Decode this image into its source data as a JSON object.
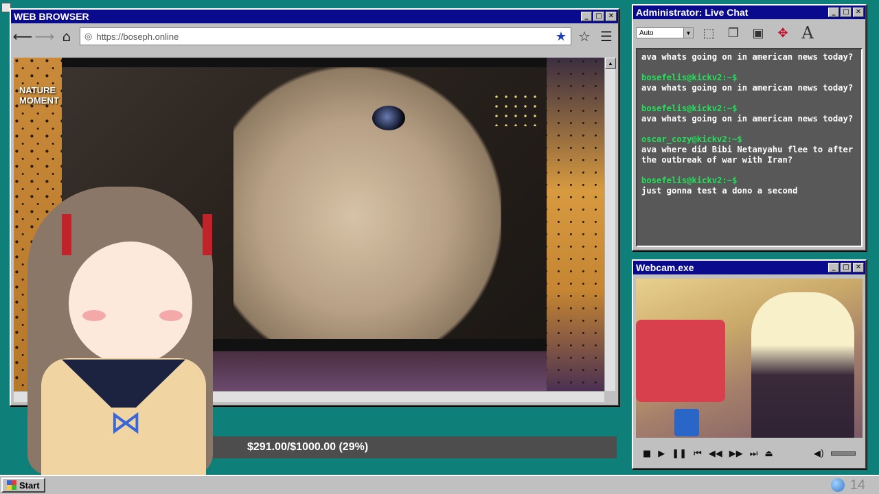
{
  "browser": {
    "title": "WEB BROWSER",
    "url": "https://boseph.online",
    "video_overlay_text": "NATURE\nMOMENT"
  },
  "chat": {
    "title": "Administrator: Live Chat",
    "font_size_select": "Auto",
    "messages": [
      {
        "user": "",
        "text": "ava whats going on in american news today?"
      },
      {
        "user": "bosefelis@kickv2:~$",
        "text": "ava whats going on in american news today?"
      },
      {
        "user": "bosefelis@kickv2:~$",
        "text": "ava whats going on in american news today?"
      },
      {
        "user": "oscar_cozy@kickv2:~$",
        "text": "ava where did Bibi Netanyahu flee to after the outbreak of war with Iran?"
      },
      {
        "user": "bosefelis@kickv2:~$",
        "text": "just gonna test a dono a second"
      }
    ]
  },
  "webcam": {
    "title": "Webcam.exe"
  },
  "donation": {
    "text": "$291.00/$1000.00 (29%)",
    "raised": 291.0,
    "goal": 1000.0,
    "percent": 29
  },
  "taskbar": {
    "start_label": "Start",
    "clock": "14"
  },
  "icons": {
    "minimize": "minimize-icon",
    "maximize": "maximize-icon",
    "close": "close-icon"
  },
  "colors": {
    "desktop": "#0f7f7a",
    "titlebar": "#0a0a8c",
    "chat_user": "#22e05a"
  }
}
